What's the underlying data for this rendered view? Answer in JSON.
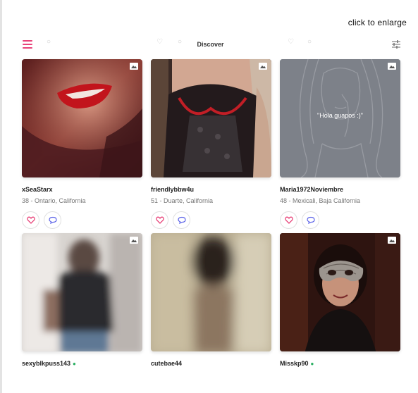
{
  "enlarge_link": "click to enlarge",
  "header": {
    "title": "Discover"
  },
  "profiles": [
    {
      "username": "xSeaStarx",
      "meta": "38 - Ontario, California"
    },
    {
      "username": "friendlybbw4u",
      "meta": "51 - Duarte, California"
    },
    {
      "username": "Maria1972Noviembre",
      "meta": "48 - Mexicali, Baja California",
      "photo_caption": "\"Hola guapos :)\""
    },
    {
      "username": "sexyblkpuss143",
      "online": "●"
    },
    {
      "username": "cutebae44"
    },
    {
      "username": "Misskp90",
      "online": "●"
    }
  ],
  "colors": {
    "accent": "#e8447a",
    "chat": "#5b62e8",
    "online": "#27ae60"
  }
}
